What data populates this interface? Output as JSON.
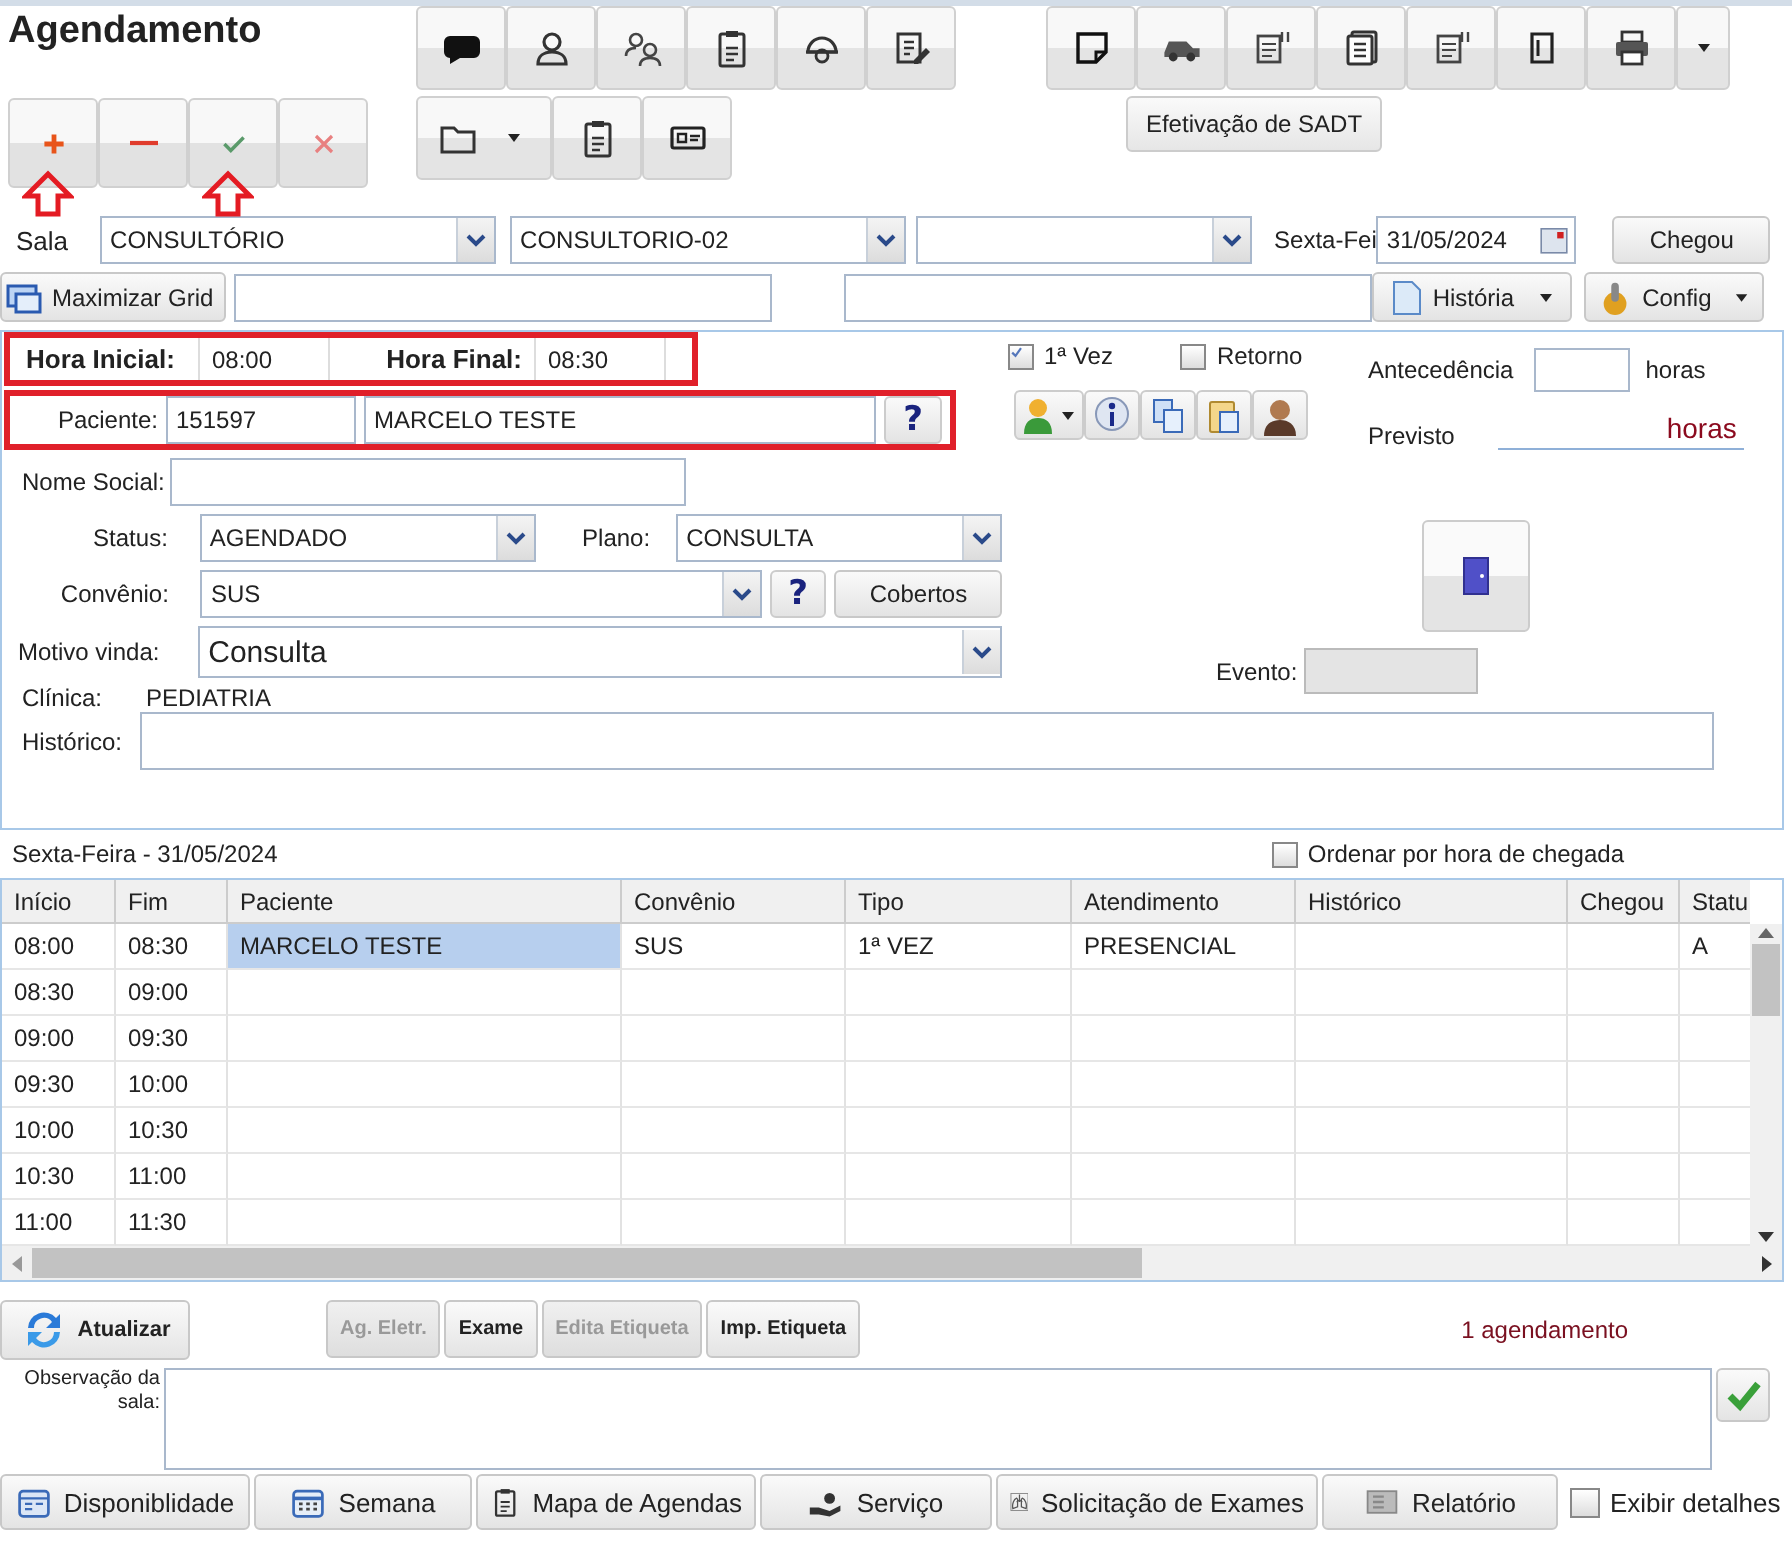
{
  "title": "Agendamento",
  "crud_buttons": [
    {
      "kind": "add",
      "arrow_marker": true
    },
    {
      "kind": "remove",
      "arrow_marker": false
    },
    {
      "kind": "confirm",
      "arrow_marker": true
    },
    {
      "kind": "cancel",
      "arrow_marker": false
    }
  ],
  "sadt_button": "Efetivação de SADT",
  "room": {
    "label": "Sala",
    "primary": "CONSULTÓRIO",
    "secondary": "CONSULTORIO-02",
    "date_label": "Sexta-Fei",
    "date": "31/05/2024",
    "arrived_button": "Chegou"
  },
  "grid_bar": {
    "maximize_button": "Maximizar Grid",
    "history_button": "História",
    "config_button": "Config"
  },
  "form": {
    "time_row": {
      "highlighted": true,
      "start_label": "Hora Inicial:",
      "start": "08:00",
      "end_label": "Hora Final:",
      "end": "08:30"
    },
    "patient_row": {
      "highlighted": true,
      "label": "Paciente:",
      "code": "151597",
      "name": "MARCELO TESTE",
      "help": "?"
    },
    "social_name": {
      "label": "Nome Social:"
    },
    "status": {
      "label": "Status:",
      "value": "AGENDADO"
    },
    "plan": {
      "label": "Plano:",
      "value": "CONSULTA"
    },
    "insurance": {
      "label": "Convênio:",
      "value": "SUS",
      "help": "?",
      "button": "Cobertos"
    },
    "reason": {
      "label": "Motivo vinda:",
      "value": "Consulta"
    },
    "clinic": {
      "label": "Clínica:",
      "value": "PEDIATRIA"
    },
    "history": {
      "label": "Histórico:"
    },
    "checkboxes": [
      {
        "label": "1ª Vez",
        "checked": true
      },
      {
        "label": "Retorno",
        "checked": false
      }
    ],
    "advance": {
      "label": "Antecedência",
      "unit": "horas"
    },
    "expected": {
      "label": "Previsto",
      "unit": "horas"
    },
    "event": {
      "label": "Evento:"
    }
  },
  "schedule": {
    "date_label": "Sexta-Feira - 31/05/2024",
    "order_checkbox": {
      "label": "Ordenar por hora de chegada",
      "checked": false
    },
    "columns": [
      "Início",
      "Fim",
      "Paciente",
      "Convênio",
      "Tipo",
      "Atendimento",
      "Histórico",
      "Chegou",
      "Statu"
    ],
    "rows": [
      {
        "start": "08:00",
        "end": "08:30",
        "patient": "MARCELO TESTE",
        "insurance": "SUS",
        "type": "1ª VEZ",
        "service": "PRESENCIAL",
        "status": "A",
        "selected": true
      },
      {
        "start": "08:30",
        "end": "09:00",
        "selected": false
      },
      {
        "start": "09:00",
        "end": "09:30",
        "selected": false
      },
      {
        "start": "09:30",
        "end": "10:00",
        "selected": false
      },
      {
        "start": "10:00",
        "end": "10:30",
        "selected": false
      },
      {
        "start": "10:30",
        "end": "11:00",
        "selected": false
      },
      {
        "start": "11:00",
        "end": "11:30",
        "selected": false
      }
    ]
  },
  "actions": {
    "refresh_button": "Atualizar",
    "buttons": [
      {
        "label": "Ag. Eletr.",
        "disabled": true
      },
      {
        "label": "Exame",
        "disabled": false
      },
      {
        "label": "Edita Etiqueta",
        "disabled": true
      },
      {
        "label": "Imp. Etiqueta",
        "disabled": false
      }
    ],
    "count": "1 agendamento"
  },
  "note": {
    "label": "Observação da sala:"
  },
  "footer": {
    "buttons": [
      {
        "label": "Disponiblidade",
        "kind": "calendar"
      },
      {
        "label": "Semana",
        "kind": "week"
      },
      {
        "label": "Mapa de Agendas",
        "kind": "clipboard"
      },
      {
        "label": "Serviço",
        "kind": "hand"
      },
      {
        "label": "Solicitação de Exames",
        "kind": "lungs"
      },
      {
        "label": "Relatório",
        "kind": "report"
      }
    ],
    "details_checkbox": {
      "label": "Exibir detalhes",
      "checked": false
    }
  }
}
